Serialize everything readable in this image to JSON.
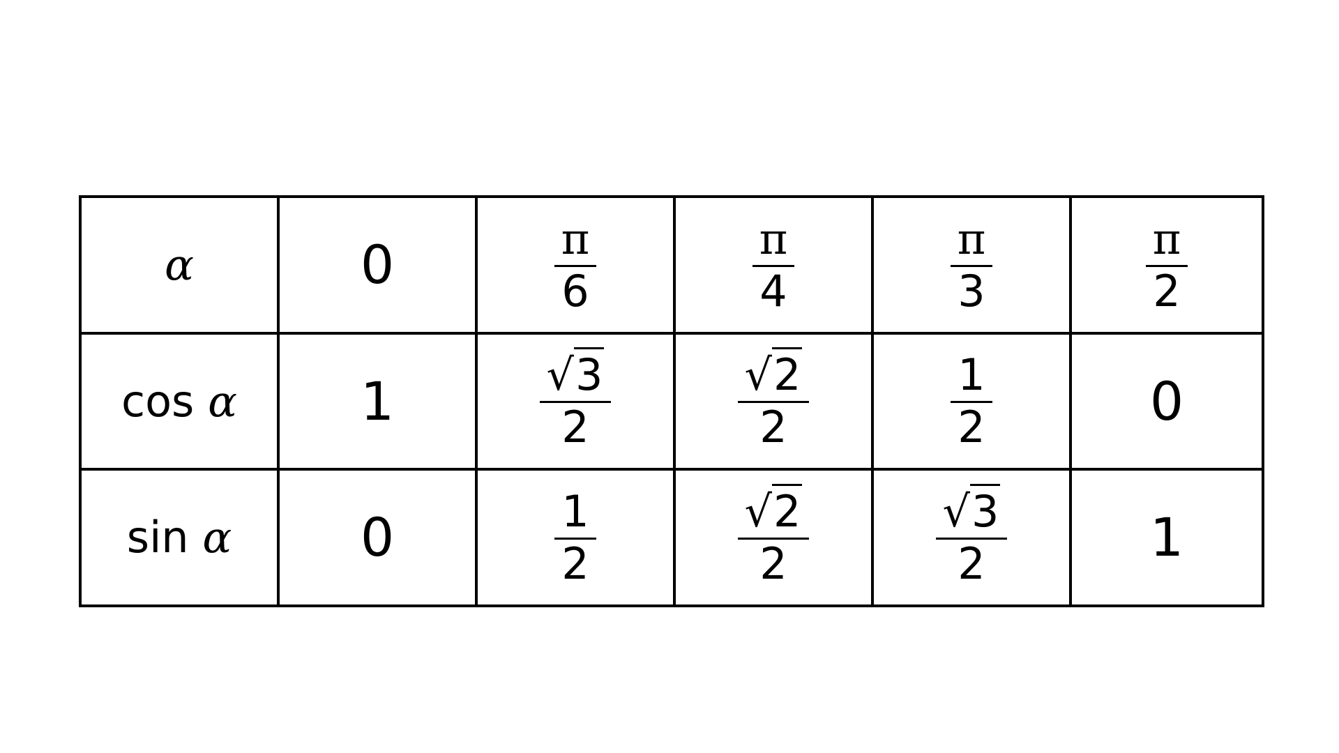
{
  "table": {
    "rows": [
      {
        "label": {
          "func": "",
          "var": "α"
        },
        "cells": [
          {
            "type": "single",
            "value": "0"
          },
          {
            "type": "frac",
            "num": "π",
            "den": "6"
          },
          {
            "type": "frac",
            "num": "π",
            "den": "4"
          },
          {
            "type": "frac",
            "num": "π",
            "den": "3"
          },
          {
            "type": "frac",
            "num": "π",
            "den": "2"
          }
        ]
      },
      {
        "label": {
          "func": "cos",
          "var": "α"
        },
        "cells": [
          {
            "type": "single",
            "value": "1"
          },
          {
            "type": "sqrtfrac",
            "radical": "√",
            "rad": "3",
            "den": "2"
          },
          {
            "type": "sqrtfrac",
            "radical": "√",
            "rad": "2",
            "den": "2"
          },
          {
            "type": "frac",
            "num": "1",
            "den": "2"
          },
          {
            "type": "single",
            "value": "0"
          }
        ]
      },
      {
        "label": {
          "func": "sin",
          "var": "α"
        },
        "cells": [
          {
            "type": "single",
            "value": "0"
          },
          {
            "type": "frac",
            "num": "1",
            "den": "2"
          },
          {
            "type": "sqrtfrac",
            "radical": "√",
            "rad": "2",
            "den": "2"
          },
          {
            "type": "sqrtfrac",
            "radical": "√",
            "rad": "3",
            "den": "2"
          },
          {
            "type": "single",
            "value": "1"
          }
        ]
      }
    ]
  }
}
